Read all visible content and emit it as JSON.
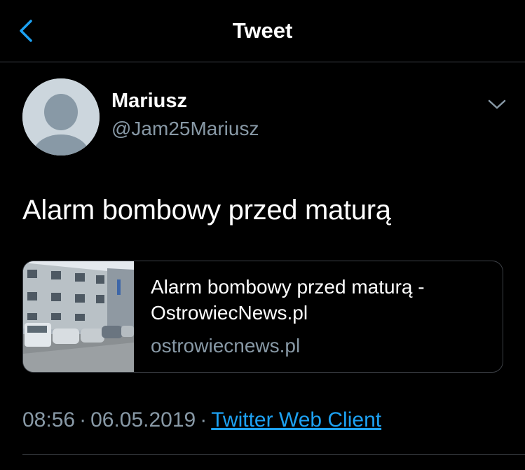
{
  "header": {
    "title": "Tweet",
    "back_icon": "chevron-left-icon"
  },
  "author": {
    "name": "Mariusz",
    "handle": "@Jam25Mariusz",
    "avatar_icon": "default-avatar-icon"
  },
  "tweet": {
    "text": "Alarm bombowy przed maturą"
  },
  "link_card": {
    "title_line1": "Alarm bombowy przed maturą -",
    "title_line2": "OstrowiecNews.pl",
    "domain": "ostrowiecnews.pl"
  },
  "meta": {
    "time": "08:56",
    "separator": "·",
    "date": "06.05.2019",
    "source": "Twitter Web Client"
  },
  "colors": {
    "background": "#000000",
    "text_primary": "#ffffff",
    "text_secondary": "#8899a6",
    "accent": "#1da1f2",
    "border": "#3d4147"
  }
}
